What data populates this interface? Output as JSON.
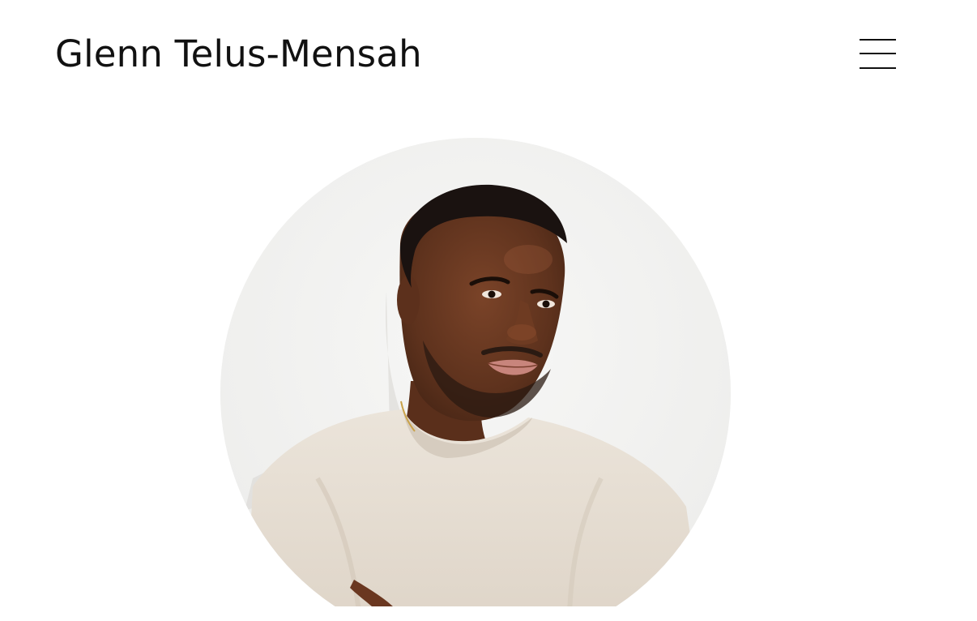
{
  "header": {
    "site_title": "Glenn Telus-Mensah",
    "menu_icon": "hamburger-menu-icon"
  },
  "portrait": {
    "subject": "profile-photo",
    "background_color": "#f3f3f2",
    "skin_color": "#6b3a22",
    "shirt_color": "#e6ddd1",
    "hair_color": "#1a1210"
  },
  "colors": {
    "text": "#111111",
    "page_background": "#ffffff"
  }
}
